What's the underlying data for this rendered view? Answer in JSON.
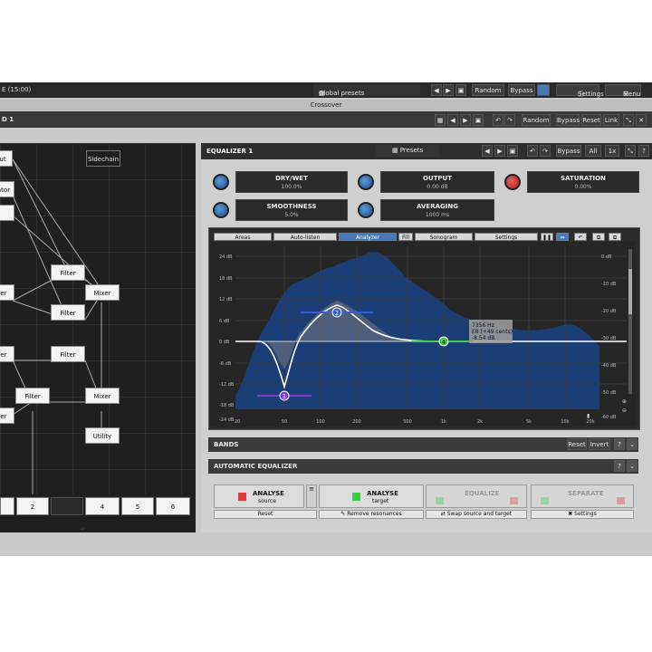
{
  "topbar": {
    "title": "E (15:00)",
    "global_presets": "Global presets",
    "random": "Random",
    "bypass": "Bypass",
    "settings": "Settings",
    "menu": "Menu"
  },
  "subbar": {
    "title": "Crossover"
  },
  "bar2": {
    "left_label": "D 1",
    "random": "Random",
    "bypass": "Bypass",
    "reset": "Reset",
    "link": "Link"
  },
  "routing": {
    "nodes": {
      "out": "ut",
      "sidechain": "Sidechain",
      "ator": "ator",
      "filter1": "Filter",
      "mixer1": "Mixer",
      "filter2": "Filter",
      "er1": "er",
      "er2": "er",
      "filter3": "Filter",
      "filter4": "Filter",
      "mixer2": "Mixer",
      "er3": "er",
      "utility": "Utility"
    },
    "numbers": [
      "2",
      "4",
      "5",
      "6"
    ]
  },
  "eq": {
    "title": "EQUALIZER 1",
    "presets": "Presets",
    "bypass": "Bypass",
    "all": "All",
    "ratio": "1x",
    "params": {
      "drywet": {
        "name": "DRY/WET",
        "value": "100.0%"
      },
      "output": {
        "name": "OUTPUT",
        "value": "0.00 dB"
      },
      "saturation": {
        "name": "SATURATION",
        "value": "0.00%"
      },
      "smoothness": {
        "name": "SMOOTHNESS",
        "value": "5.0%"
      },
      "averaging": {
        "name": "AVERAGING",
        "value": "1000 ms"
      }
    },
    "tabs": [
      "Areas",
      "Auto-listen",
      "Analyzer",
      "Fill",
      "Sonogram",
      "Settings"
    ],
    "y_labels_left": [
      "24 dB",
      "18 dB",
      "12 dB",
      "6 dB",
      "0 dB",
      "-6 dB",
      "-12 dB",
      "-18 dB",
      "-24 dB"
    ],
    "y_labels_right": [
      "0 dB",
      "-10 dB",
      "-20 dB",
      "-30 dB",
      "-40 dB",
      "-50 dB",
      "-60 dB"
    ],
    "x_labels": [
      "20",
      "50",
      "100",
      "200",
      "500",
      "1k",
      "2k",
      "5k",
      "10k",
      "20k"
    ],
    "band_markers": [
      "1",
      "2",
      "4"
    ],
    "tooltip_line1": "7356 Hz",
    "tooltip_line2": "E8 (+49 cents)",
    "tooltip_line3": "-8.54 dB",
    "bands_title": "BANDS",
    "bands_reset": "Reset",
    "bands_invert": "Invert",
    "auto_title": "AUTOMATIC EQUALIZER",
    "analyse_source_l1": "ANALYSE",
    "analyse_source_l2": "source",
    "analyse_target_l1": "ANALYSE",
    "analyse_target_l2": "target",
    "equalize_l1": "EQUALIZE",
    "equalize_l2": "",
    "separate_l1": "SEPARATE",
    "separate_l2": "",
    "btn_reset": "Reset",
    "btn_remove": "Remove resonances",
    "btn_swap": "Swap source and target",
    "btn_settings": "Settings"
  },
  "colors": {
    "accent_blue": "#4a78b5",
    "spectrum": "#1a3f7a",
    "band1": "#7a3fd0",
    "band2": "#3a5bd8",
    "band4": "#3fd04a",
    "red_indicator": "#e03a3a",
    "green_indicator": "#3ad03a"
  }
}
